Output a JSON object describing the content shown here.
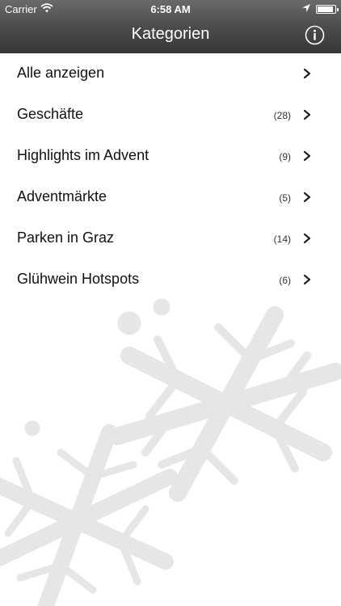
{
  "status_bar": {
    "carrier": "Carrier",
    "time": "6:58 AM",
    "battery_level": 0.92
  },
  "nav": {
    "title": "Kategorien",
    "info_icon": "info-icon"
  },
  "background": {
    "image": "snowflake-watermark",
    "color": "#e6e6e6"
  },
  "colors": {
    "header_top": "#6a6a6a",
    "header_bottom": "#363636",
    "row_text": "#111111"
  },
  "categories": [
    {
      "label": "Alle anzeigen",
      "count": ""
    },
    {
      "label": "Geschäfte",
      "count": "(28)"
    },
    {
      "label": "Highlights im Advent",
      "count": "(9)"
    },
    {
      "label": "Adventmärkte",
      "count": "(5)"
    },
    {
      "label": "Parken in Graz",
      "count": "(14)"
    },
    {
      "label": "Glühwein Hotspots",
      "count": "(6)"
    }
  ]
}
